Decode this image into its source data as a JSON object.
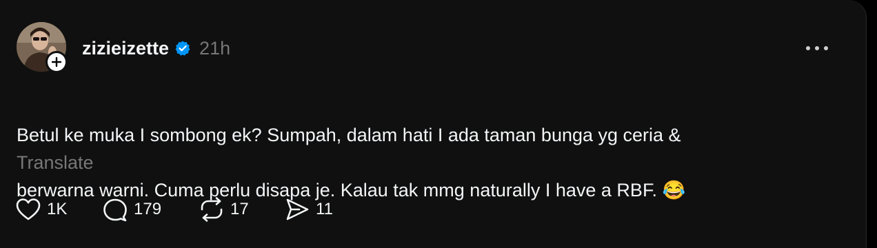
{
  "post": {
    "author": {
      "username": "zizieizette",
      "verified": true,
      "avatar_icon": "user-avatar",
      "follow_icon": "plus-icon"
    },
    "timestamp": "21h",
    "body_line1": "Betul ke muka I sombong ek? Sumpah, dalam hati I ada taman bunga yg ceria &",
    "body_line2": "berwarna warni. Cuma perlu disapa je. Kalau tak mmg naturally I have a RBF. 😂",
    "translate_label": "Translate",
    "actions": {
      "like_count": "1K",
      "reply_count": "179",
      "repost_count": "17",
      "share_count": "11"
    }
  },
  "colors": {
    "background": "#101010",
    "text_primary": "#f3f5f7",
    "text_secondary": "#777777",
    "verified_blue": "#0095f6"
  }
}
